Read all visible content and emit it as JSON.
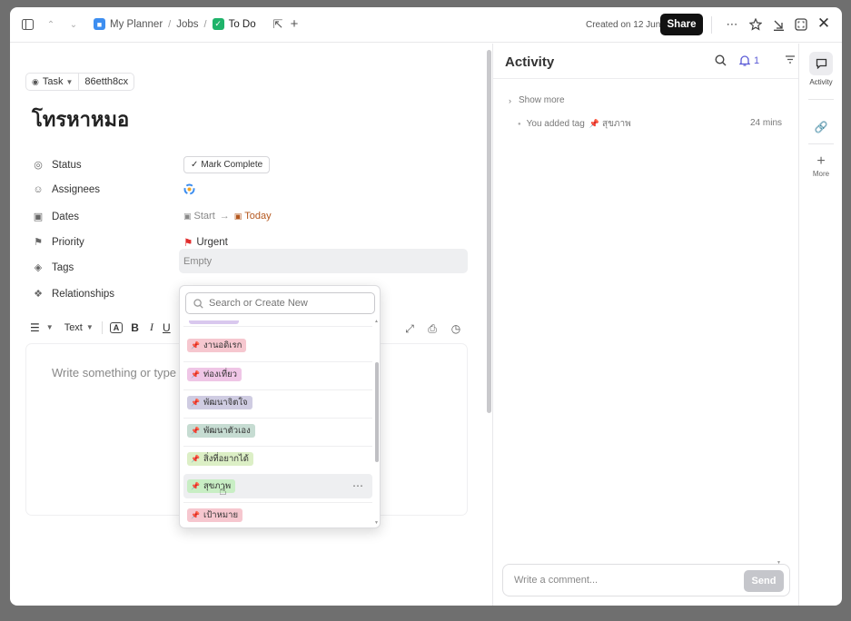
{
  "breadcrumb": {
    "space": "My Planner",
    "list": "Jobs",
    "task_list": "To Do"
  },
  "header": {
    "created": "Created on 12 Jun",
    "share_label": "Share"
  },
  "task": {
    "type_label": "Task",
    "id": "86etth8cx",
    "title": "โทรหาหมอ"
  },
  "fields": {
    "status_label": "Status",
    "status_value": "Mark Complete",
    "assignees_label": "Assignees",
    "dates_label": "Dates",
    "dates_start": "Start",
    "dates_end": "Today",
    "priority_label": "Priority",
    "priority_value": "Urgent",
    "tags_label": "Tags",
    "tags_value": "Empty",
    "relationships_label": "Relationships"
  },
  "editor": {
    "text_style": "Text",
    "placeholder": "Write something or type"
  },
  "tag_dropdown": {
    "search_placeholder": "Search or Create New",
    "items": [
      {
        "label": "งานอดิเรก",
        "color": "#f6c7cf"
      },
      {
        "label": "ท่องเที่ยว",
        "color": "#efc6e6"
      },
      {
        "label": "พัฒนาจิตใจ",
        "color": "#cfcce2"
      },
      {
        "label": "พัฒนาตัวเอง",
        "color": "#c6dcd2"
      },
      {
        "label": "สิ่งที่อยากได้",
        "color": "#dcefc6"
      },
      {
        "label": "สุขภาพ",
        "color": "#c8eec4"
      },
      {
        "label": "เป้าหมาย",
        "color": "#f6c7cf"
      }
    ],
    "highlighted_index": 5
  },
  "activity": {
    "title": "Activity",
    "notif_count": "1",
    "show_more": "Show more",
    "entry_text": "You added tag",
    "entry_tag": "สุขภาพ",
    "entry_time": "24 mins",
    "comment_placeholder": "Write a comment...",
    "send_label": "Send"
  },
  "rail": {
    "activity_label": "Activity",
    "more_label": "More"
  },
  "colors": {
    "accent": "#7b68ee",
    "urgent": "#e12d2d",
    "today": "#b5581f",
    "pin": "#e2334f"
  }
}
